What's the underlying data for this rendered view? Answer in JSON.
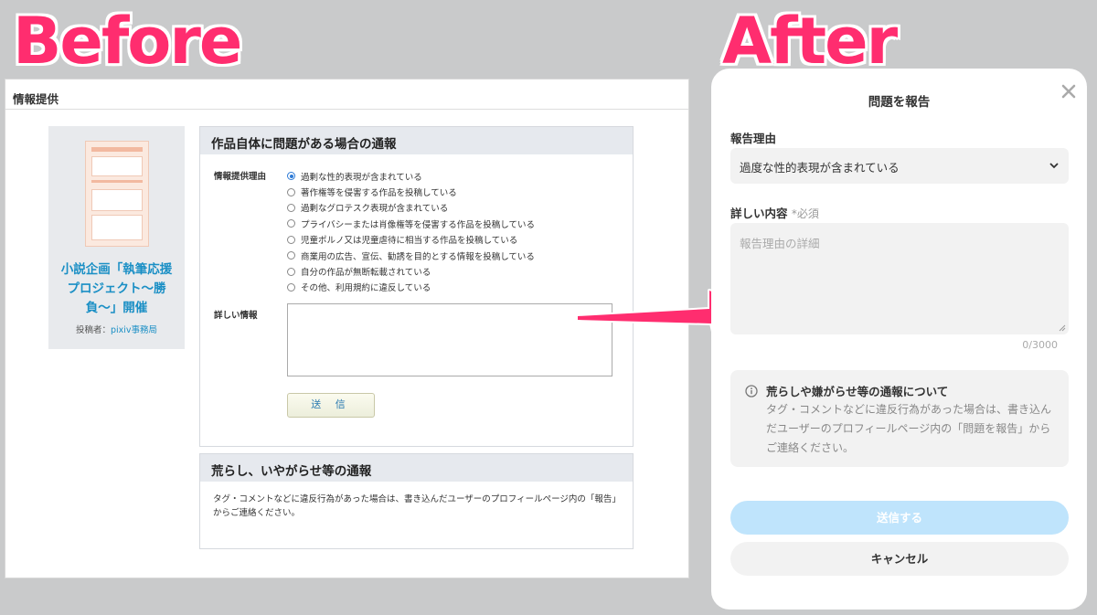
{
  "labels": {
    "before": "Before",
    "after": "After"
  },
  "before": {
    "header": "情報提供",
    "work": {
      "title": "小説企画「執筆応援プロジェクト〜勝負〜」開催",
      "author_prefix": "投稿者：",
      "author": "pixiv事務局"
    },
    "report_section": {
      "title": "作品自体に問題がある場合の通報",
      "reason_label": "情報提供理由",
      "reasons": [
        "過剰な性的表現が含まれている",
        "著作権等を侵害する作品を投稿している",
        "過剰なグロテスク表現が含まれている",
        "プライバシーまたは肖像権等を侵害する作品を投稿している",
        "児童ポルノ又は児童虐待に相当する作品を投稿している",
        "商業用の広告、宣伝、勧誘を目的とする情報を投稿している",
        "自分の作品が無断転載されている",
        "その他、利用規約に違反している"
      ],
      "selected_index": 0,
      "detail_label": "詳しい情報",
      "submit_label": "送 信"
    },
    "harass_section": {
      "title": "荒らし、いやがらせ等の通報",
      "body": "タグ・コメントなどに違反行為があった場合は、書き込んだユーザーのプロフィールページ内の「報告」からご連絡ください。"
    }
  },
  "after": {
    "title": "問題を報告",
    "reason_label": "報告理由",
    "reason_value": "過度な性的表現が含まれている",
    "detail_label": "詳しい内容",
    "required_label": "*必須",
    "detail_placeholder": "報告理由の詳細",
    "char_count": "0/3000",
    "info_title": "荒らしや嫌がらせ等の通報について",
    "info_body": "タグ・コメントなどに違反行為があった場合は、書き込んだユーザーのプロフィールページ内の「問題を報告」からご連絡ください。",
    "send_label": "送信する",
    "cancel_label": "キャンセル"
  },
  "colors": {
    "label_pink": "#ff2d6f",
    "link_blue": "#1a8fc5",
    "send_button_disabled": "#bfe4fc",
    "page_bg": "#c9cacb"
  }
}
